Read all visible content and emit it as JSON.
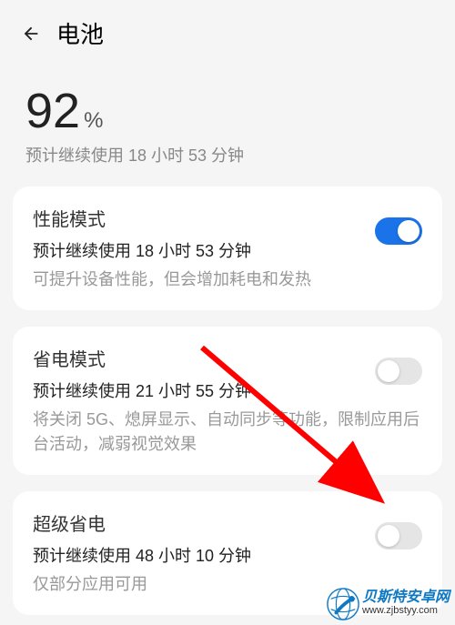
{
  "header": {
    "title": "电池"
  },
  "battery": {
    "percent_value": "92",
    "percent_symbol": "%",
    "estimate": "预计继续使用 18 小时 53 分钟"
  },
  "modes": {
    "performance": {
      "title": "性能模式",
      "subtitle": "预计继续使用 18 小时 53 分钟",
      "desc": "可提升设备性能，但会增加耗电和发热",
      "enabled": true
    },
    "power_save": {
      "title": "省电模式",
      "subtitle": "预计继续使用 21 小时 55 分钟",
      "desc": "将关闭 5G、熄屏显示、自动同步等功能，限制应用后台活动，减弱视觉效果",
      "enabled": false
    },
    "super_save": {
      "title": "超级省电",
      "subtitle": "预计继续使用 48 小时 10 分钟",
      "desc": "仅部分应用可用",
      "enabled": false
    }
  },
  "watermark": {
    "cn": "贝斯特安卓网",
    "url": "www.zjbstyy.com"
  },
  "colors": {
    "toggle_on": "#1a73e8",
    "arrow": "#ff0000",
    "watermark_blue": "#0d78c4"
  }
}
